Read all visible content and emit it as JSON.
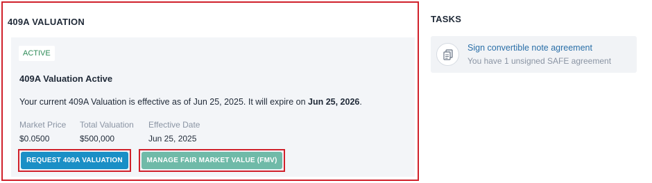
{
  "valuation": {
    "section_title": "409A VALUATION",
    "badge": "ACTIVE",
    "card_title": "409A Valuation Active",
    "summary_prefix": "Your current 409A Valuation is effective as of Jun 25, 2025. It will expire on ",
    "summary_expiry": "Jun 25, 2026",
    "summary_suffix": ".",
    "metrics": [
      {
        "label": "Market Price",
        "value": "$0.0500"
      },
      {
        "label": "Total Valuation",
        "value": "$500,000"
      },
      {
        "label": "Effective Date",
        "value": "Jun 25, 2025"
      }
    ],
    "buttons": {
      "request": "REQUEST 409A VALUATION",
      "manage": "MANAGE FAIR MARKET VALUE (FMV)"
    }
  },
  "tasks": {
    "title": "TASKS",
    "items": [
      {
        "icon": "document-stack-icon",
        "title": "Sign convertible note agreement",
        "subtitle": "You have 1 unsigned SAFE agreement"
      }
    ]
  },
  "colors": {
    "highlight_border": "#d0202a",
    "badge_text": "#2e8b57",
    "primary_button": "#1a8fc6",
    "secondary_button": "#6fbaa8",
    "task_link": "#2a6fa8"
  }
}
